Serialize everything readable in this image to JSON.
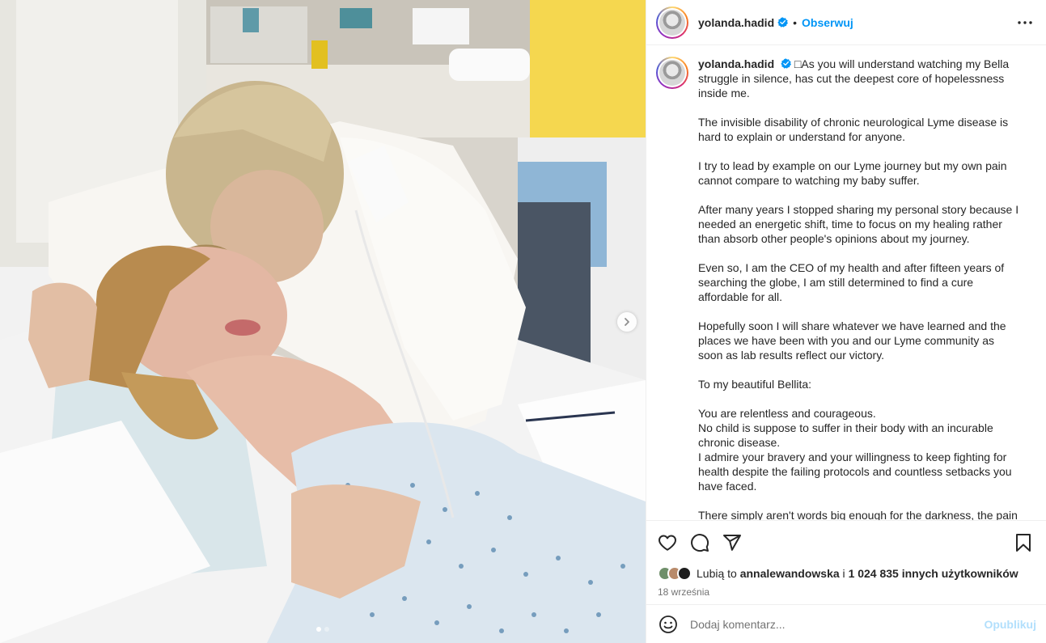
{
  "post": {
    "username": "yolanda.hadid",
    "follow_label": "Obserwuj",
    "bullet": "•",
    "image_alt": "photo: a mother hugging and kissing her daughter lying in a hospital bed",
    "caption": {
      "username": "yolanda.hadid",
      "lead": "□As you will understand watching my Bella struggle in silence, has cut the deepest core of hopelessness inside me.",
      "paragraphs": [
        "The invisible disability of chronic neurological Lyme disease is hard to explain or understand for anyone.",
        "I try to lead by example on our Lyme journey but my own pain cannot compare to watching my baby suffer.",
        "After many years I stopped sharing my personal story because I needed an energetic shift, time to focus on my healing rather than absorb other people's opinions about my journey.",
        "Even so, I am the CEO of my health and after fifteen years of searching the globe, I am still determined to find a cure affordable for all.",
        "Hopefully soon I will share whatever we have learned and the places we have been with you and our Lyme community as soon as lab results reflect our victory.",
        "To my beautiful Bellita:"
      ],
      "closing_lines": [
        "You are relentless and courageous.",
        "No child is suppose to suffer in their body with an incurable chronic disease.",
        "I admire your bravery and your willingness to keep fighting for health despite the failing protocols and countless setbacks you have faced."
      ],
      "cut_line": "There simply aren't words big enough for the darkness, the pain"
    },
    "likes": {
      "prefix": "Lubią to",
      "first_liker": "annalewandowska",
      "connector": "i",
      "others": "1 024 835 innych użytkowników"
    },
    "date": "18 września",
    "comment_placeholder": "Dodaj komentarz...",
    "publish_label": "Opublikuj"
  },
  "icons": {
    "verified": "verified-badge-icon",
    "more": "more-options-icon",
    "like": "heart-icon",
    "comment": "comment-icon",
    "share": "share-icon",
    "save": "bookmark-icon",
    "emoji": "emoji-icon",
    "next": "chevron-right-icon"
  },
  "colors": {
    "link_blue": "#0095f6",
    "verified_blue": "#0095f6",
    "publish_disabled": "#b2dffc",
    "secondary_text": "#737373"
  },
  "carousel": {
    "total": 2,
    "current": 1
  }
}
